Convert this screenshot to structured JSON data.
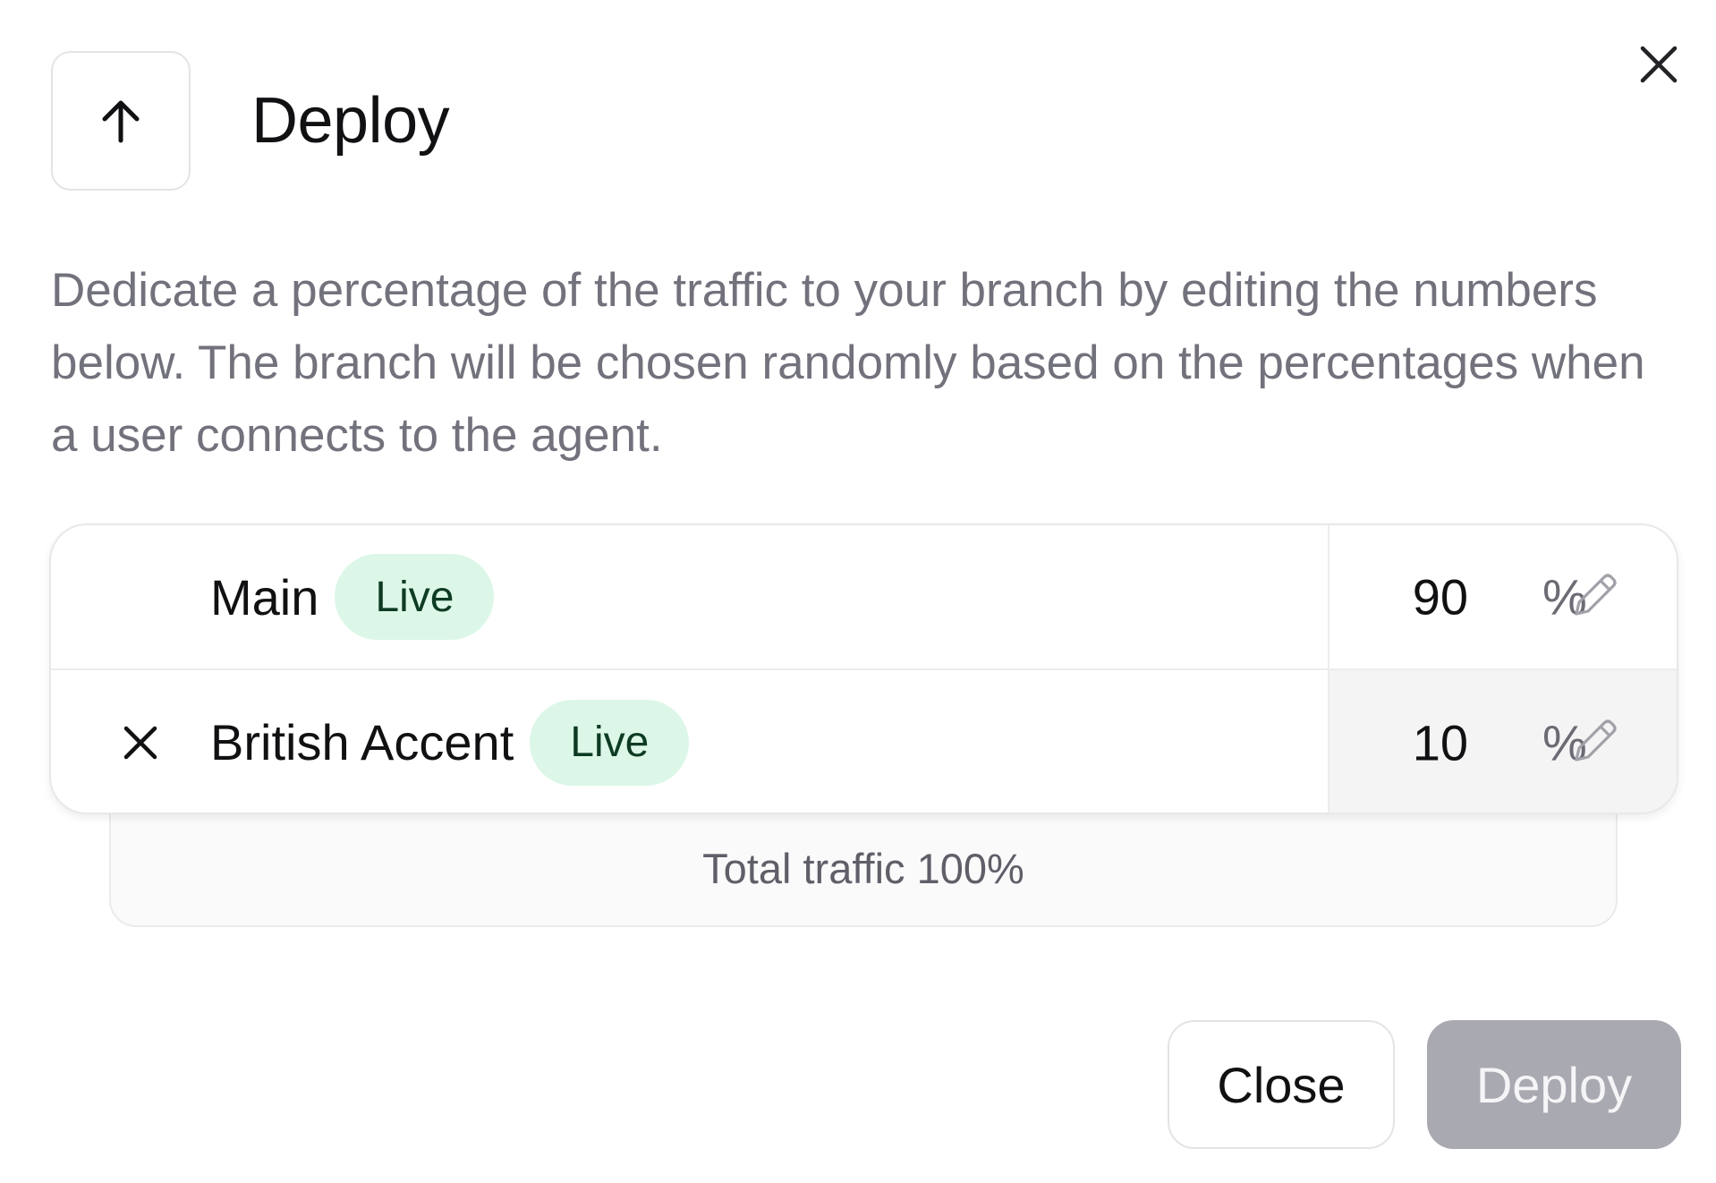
{
  "dialog": {
    "title": "Deploy",
    "description": "Dedicate a percentage of the traffic to your branch by editing the numbers below. The branch will be chosen randomly based on the percentages when a user connects to the agent."
  },
  "branches": [
    {
      "name": "Main",
      "badge": "Live",
      "percent": "90",
      "unit": "%",
      "removable": false
    },
    {
      "name": "British Accent",
      "badge": "Live",
      "percent": "10",
      "unit": "%",
      "removable": true
    }
  ],
  "total": {
    "label": "Total traffic 100%"
  },
  "buttons": {
    "close": "Close",
    "deploy": "Deploy"
  },
  "colors": {
    "badge_bg": "#dcf7e8",
    "badge_text": "#0e3b24",
    "deploy_disabled_bg": "#a9a9b1",
    "description_text": "#72727d"
  },
  "icons": {
    "header": "arrow-up-icon",
    "close": "close-icon",
    "remove": "remove-icon",
    "edit": "pencil-icon"
  }
}
